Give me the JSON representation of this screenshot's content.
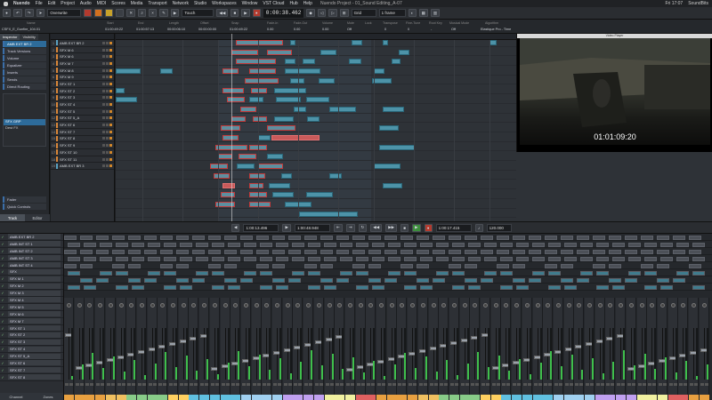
{
  "menubar": {
    "app_name": "Nuendo",
    "items": [
      "File",
      "Edit",
      "Project",
      "Audio",
      "MIDI",
      "Scores",
      "Media",
      "Transport",
      "Network",
      "Studio",
      "Workspaces",
      "Window",
      "VST Cloud",
      "Hub",
      "Help"
    ],
    "window_title": "Nuendo Project - 01_Sound Editing_A-07",
    "clock": "Fri 17:07",
    "user": "SoundBits"
  },
  "toolbar": {
    "automation_mode": "Overwrite",
    "timecode": "0:00:38.462",
    "grid_label": "Grid",
    "quantize": "1 frame"
  },
  "infoline": {
    "headers": [
      "Name",
      "Start",
      "End",
      "Length",
      "Offset",
      "Snap",
      "Fade-In",
      "Fade-Out",
      "Volume",
      "Mute",
      "Lock",
      "Transpose",
      "Fine-Tune",
      "Root Key",
      "Musical Mode",
      "Algorithm"
    ],
    "values": [
      "CSFX_E_Gunfire_104.01",
      "01:00:49:22",
      "01:00:57:13",
      "00:00:06:10",
      "00:00:00:00",
      "01:00:49:22",
      "0.00",
      "0.00",
      "0.00",
      "Off",
      "",
      "0",
      "0",
      "-",
      "Off",
      "Elastique Pro - Time"
    ]
  },
  "inspector": {
    "tabs": [
      "Inspector",
      "Visibility"
    ],
    "selected_track": "AMB EXT BR 2",
    "sections": [
      "Track Versions",
      "Volume",
      "Equalizer",
      "Inserts",
      "Sends",
      "Direct Routing"
    ],
    "slot_selected": "SFX GRP",
    "slot_name": "Dest FX",
    "lower_sections": [
      "Fader",
      "Quick Controls"
    ],
    "bottom_tabs": [
      "Track",
      "Editor"
    ]
  },
  "tracks": [
    {
      "num": "1",
      "name": "AMB EXT BR 2",
      "color": "#5aa0c0"
    },
    {
      "num": "2",
      "name": "SFX M 6",
      "color": "#d98638"
    },
    {
      "num": "3",
      "name": "SFX M 6",
      "color": "#d98638"
    },
    {
      "num": "4",
      "name": "SFX M 7",
      "color": "#d98638"
    },
    {
      "num": "5",
      "name": "SFX M 8",
      "color": "#d98638"
    },
    {
      "num": "6",
      "name": "SFX M 9",
      "color": "#d98638"
    },
    {
      "num": "7",
      "name": "SFX ST 1",
      "color": "#d98638"
    },
    {
      "num": "8",
      "name": "SFX ST 2",
      "color": "#d98638"
    },
    {
      "num": "9",
      "name": "SFX ST 3",
      "color": "#d98638"
    },
    {
      "num": "10",
      "name": "SFX ST 4",
      "color": "#d98638"
    },
    {
      "num": "11",
      "name": "SFX ST 5",
      "color": "#d98638"
    },
    {
      "num": "12",
      "name": "SFX ST 5_A",
      "color": "#d98638"
    },
    {
      "num": "13",
      "name": "SFX ST 6",
      "color": "#d98638"
    },
    {
      "num": "14",
      "name": "SFX ST 7",
      "color": "#d98638"
    },
    {
      "num": "15",
      "name": "SFX ST 8",
      "color": "#d98638"
    },
    {
      "num": "16",
      "name": "SFX ST 9",
      "color": "#d98638"
    },
    {
      "num": "17",
      "name": "SFX ST 10",
      "color": "#d98638"
    },
    {
      "num": "18",
      "name": "SFX ST 11",
      "color": "#d98638"
    },
    {
      "num": "19",
      "name": "AMB EXT BR 3",
      "color": "#5aa0c0"
    }
  ],
  "video": {
    "title": "Video Player",
    "timecode": "01:01:09:20"
  },
  "transport": {
    "left_locator": "1:00:13.496",
    "right_locator": "1:00:48.948",
    "position": "1:00:17.415",
    "tempo": "120.000"
  },
  "mixer_tracks": [
    {
      "name": "AMB EXT BR 2"
    },
    {
      "name": "AMB INT ST 1"
    },
    {
      "name": "AMB INT ST 2"
    },
    {
      "name": "AMB INT ST 3"
    },
    {
      "name": "AMB INT ST 4"
    },
    {
      "name": "SFX"
    },
    {
      "name": "SFX M 1"
    },
    {
      "name": "SFX M 2"
    },
    {
      "name": "SFX M 3"
    },
    {
      "name": "SFX M 4"
    },
    {
      "name": "SFX M 5"
    },
    {
      "name": "SFX M 6"
    },
    {
      "name": "SFX M 7"
    },
    {
      "name": "SFX ST 1"
    },
    {
      "name": "SFX ST 2"
    },
    {
      "name": "SFX ST 3"
    },
    {
      "name": "SFX ST 4"
    },
    {
      "name": "SFX ST 5_A"
    },
    {
      "name": "SFX ST 6"
    },
    {
      "name": "SFX ST 7"
    },
    {
      "name": "SFX ST 8"
    }
  ],
  "mixer_tabs": [
    "Channel",
    "Zones"
  ],
  "colors": {
    "accent": "#3a6ea8",
    "clip": "#4d93a8",
    "clip_selected_border": "#c23a3a",
    "meter": "#3fbf4c"
  }
}
